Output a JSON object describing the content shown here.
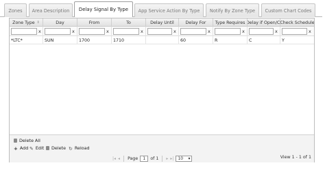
{
  "tabs": [
    {
      "label": "Zones"
    },
    {
      "label": "Area Description"
    },
    {
      "label": "Delay Signal By Type",
      "active": true
    },
    {
      "label": "App Service Action By Type"
    },
    {
      "label": "Notify By Zone Type"
    },
    {
      "label": "Custom Chart Codes"
    }
  ],
  "grid": {
    "columns": [
      "Zone Type",
      "Day",
      "From",
      "To",
      "Delay Until",
      "Delay For",
      "Type Requires",
      "Delay if Open/Cl",
      "Check Schedule"
    ],
    "sort_icon": "⇕",
    "filter_clear": "x",
    "rows": [
      [
        "*LTC*",
        "SUN",
        "1700",
        "1710",
        "",
        "60",
        "R",
        "C",
        "Y"
      ]
    ]
  },
  "footer": {
    "delete_all": "Delete All",
    "add": "Add",
    "edit": "Edit",
    "delete": "Delete",
    "reload": "Reload"
  },
  "pager": {
    "first": "|◂",
    "prev": "◂",
    "page_label": "Page",
    "page_value": "1",
    "of_label": "of 1",
    "next": "▸",
    "last": "▸|",
    "page_size": "10",
    "view_info": "View 1 - 1 of 1"
  }
}
